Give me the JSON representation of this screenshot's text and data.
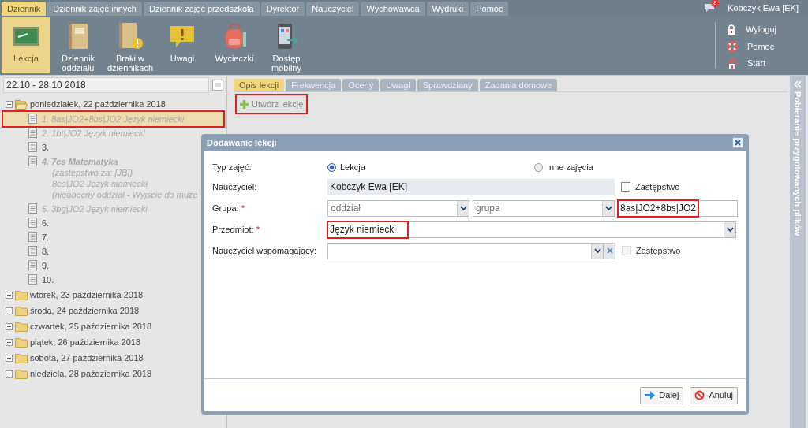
{
  "top_tabs": [
    {
      "label": "Dziennik",
      "selected": true
    },
    {
      "label": "Dziennik zajęć innych",
      "selected": false
    },
    {
      "label": "Dziennik zajęć przedszkola",
      "selected": false
    },
    {
      "label": "Dyrektor",
      "selected": false
    },
    {
      "label": "Nauczyciel",
      "selected": false
    },
    {
      "label": "Wychowawca",
      "selected": false
    },
    {
      "label": "Wydruki",
      "selected": false
    },
    {
      "label": "Pomoc",
      "selected": false
    }
  ],
  "user": {
    "name": "Kobczyk Ewa [EK]",
    "badge": "8"
  },
  "ribbon": [
    {
      "kind": "board",
      "label": "Lekcja",
      "selected": true
    },
    {
      "kind": "book",
      "label": "Dziennik oddziału",
      "selected": false
    },
    {
      "kind": "book-warning",
      "label": "Braki w dziennikach",
      "selected": false
    },
    {
      "kind": "note",
      "label": "Uwagi",
      "selected": false
    },
    {
      "kind": "backpack",
      "label": "Wycieczki",
      "selected": false
    },
    {
      "kind": "phone",
      "label": "Dostęp mobilny",
      "selected": false
    }
  ],
  "side_links": [
    {
      "kind": "lock",
      "label": "Wyloguj"
    },
    {
      "kind": "lifebuoy",
      "label": "Pomoc"
    },
    {
      "kind": "home",
      "label": "Start"
    }
  ],
  "week": "22.10 - 28.10 2018",
  "days": [
    {
      "label": "poniedziałek, 22 października 2018",
      "expanded": true,
      "lessons": [
        {
          "selected": true,
          "highlighted": true,
          "lines": [
            {
              "kind": "title",
              "text": "1. 8as|JO2+8bs|JO2 Język niemiecki"
            }
          ]
        },
        {
          "selected": false,
          "highlighted": false,
          "lines": [
            {
              "kind": "title",
              "text": "2. 1bt|JO2 Język niemiecki"
            }
          ]
        },
        {
          "selected": false,
          "highlighted": false,
          "lines": [
            {
              "kind": "empty",
              "text": "3."
            }
          ]
        },
        {
          "selected": false,
          "highlighted": false,
          "lines": [
            {
              "kind": "bold",
              "text": "4. 7cs Matematyka"
            },
            {
              "kind": "note",
              "text": "(zastepstwo za: [JB])"
            },
            {
              "kind": "struck",
              "text": "8es|JO2 Język niemiecki"
            },
            {
              "kind": "note",
              "text": "(nieobecny oddział - Wyjście do muze"
            }
          ]
        },
        {
          "selected": false,
          "highlighted": false,
          "lines": [
            {
              "kind": "title",
              "text": "5. 3bg|JO2 Język niemiecki"
            }
          ]
        },
        {
          "selected": false,
          "highlighted": false,
          "lines": [
            {
              "kind": "empty",
              "text": "6."
            }
          ]
        },
        {
          "selected": false,
          "highlighted": false,
          "lines": [
            {
              "kind": "empty",
              "text": "7."
            }
          ]
        },
        {
          "selected": false,
          "highlighted": false,
          "lines": [
            {
              "kind": "empty",
              "text": "8."
            }
          ]
        },
        {
          "selected": false,
          "highlighted": false,
          "lines": [
            {
              "kind": "empty",
              "text": "9."
            }
          ]
        },
        {
          "selected": false,
          "highlighted": false,
          "lines": [
            {
              "kind": "empty",
              "text": "10."
            }
          ]
        }
      ]
    },
    {
      "label": "wtorek, 23 października 2018",
      "expanded": false
    },
    {
      "label": "środa, 24 października 2018",
      "expanded": false
    },
    {
      "label": "czwartek, 25 października 2018",
      "expanded": false
    },
    {
      "label": "piątek, 26 października 2018",
      "expanded": false
    },
    {
      "label": "sobota, 27 października 2018",
      "expanded": false
    },
    {
      "label": "niedziela, 28 października 2018",
      "expanded": false
    }
  ],
  "content_tabs": [
    {
      "label": "Opis lekcji",
      "selected": true
    },
    {
      "label": "Frekwencja",
      "selected": false
    },
    {
      "label": "Oceny",
      "selected": false
    },
    {
      "label": "Uwagi",
      "selected": false
    },
    {
      "label": "Sprawdziany",
      "selected": false
    },
    {
      "label": "Zadania domowe",
      "selected": false
    }
  ],
  "create_button": {
    "label": "Utwórz lekcję",
    "highlighted": true
  },
  "right_panel": "Pobieranie przygotowanych plików",
  "dialog": {
    "title": "Dodawanie lekcji",
    "type": {
      "label": "Typ zajęć:",
      "options": [
        {
          "label": "Lekcja",
          "selected": true
        },
        {
          "label": "Inne zajęcia",
          "selected": false
        }
      ]
    },
    "teacher": {
      "label": "Nauczyciel:",
      "value": "Kobczyk Ewa [EK]",
      "substitute": {
        "label": "Zastępstwo",
        "checked": false,
        "disabled": false
      }
    },
    "group": {
      "label": "Grupa:",
      "required": "*",
      "class_placeholder": "oddział",
      "group_placeholder": "grupa",
      "value": "8as|JO2+8bs|JO2",
      "highlighted": true
    },
    "subject": {
      "label": "Przedmiot:",
      "required": "*",
      "value": "Język niemiecki",
      "highlighted": true
    },
    "assistant": {
      "label": "Nauczyciel wspomagający:",
      "substitute": {
        "label": "Zastępstwo",
        "checked": false,
        "disabled": true
      }
    },
    "buttons": [
      {
        "kind": "next",
        "label": "Dalej"
      },
      {
        "kind": "cancel",
        "label": "Anuluj"
      }
    ]
  }
}
